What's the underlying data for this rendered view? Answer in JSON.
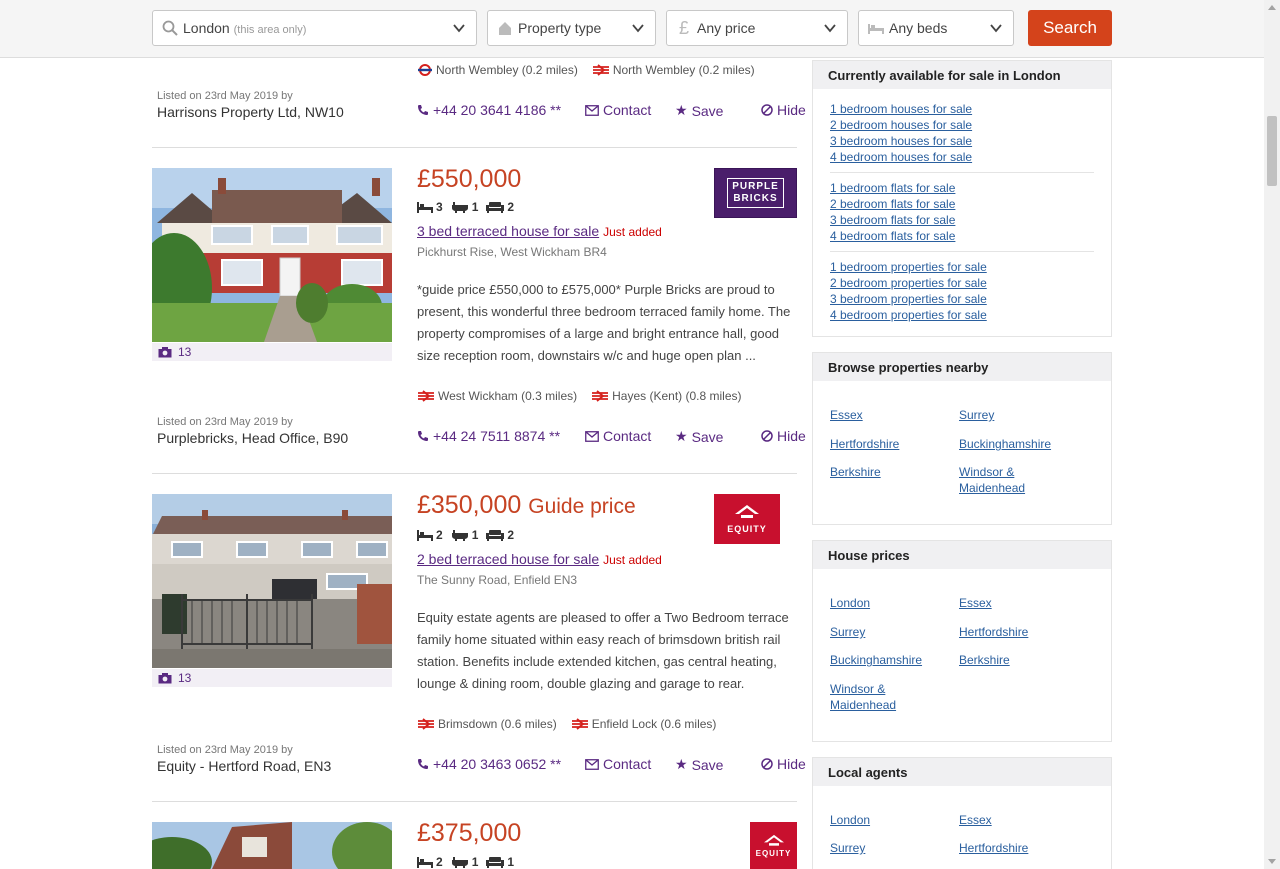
{
  "search": {
    "location": "London",
    "location_hint": "(this area only)",
    "property_type": "Property type",
    "price": "Any price",
    "beds": "Any beds",
    "button": "Search"
  },
  "listing0": {
    "station_tube": "North Wembley (0.2 miles)",
    "station_rail": "North Wembley (0.2 miles)",
    "listed_on": "Listed on 23rd May 2019 by",
    "agent": "Harrisons Property Ltd, NW10",
    "phone": "+44 20 3641 4186 **",
    "contact": "Contact",
    "save": "Save",
    "hide": "Hide"
  },
  "listing1": {
    "price": "£550,000",
    "beds": "3",
    "baths": "1",
    "receptions": "2",
    "title": "3 bed terraced house for sale",
    "badge": "Just added",
    "address": "Pickhurst Rise, West Wickham BR4",
    "description": "*guide price £550,000 to £575,000* Purple Bricks are proud to present, this wonderful three bedroom terraced family home. The property compromises of a large and bright entrance hall, good size reception room, downstairs w/c and huge open plan ...",
    "photos": "13",
    "logo_line1": "PURPLE",
    "logo_line2": "BRICKS",
    "station1": "West Wickham (0.3 miles)",
    "station2": "Hayes (Kent) (0.8 miles)",
    "listed_on": "Listed on 23rd May 2019 by",
    "agent": "Purplebricks, Head Office, B90",
    "phone": "+44 24 7511 8874 **",
    "contact": "Contact",
    "save": "Save",
    "hide": "Hide"
  },
  "listing2": {
    "price": "£350,000",
    "price_qualifier": "Guide price",
    "beds": "2",
    "baths": "1",
    "receptions": "2",
    "title": "2 bed terraced house for sale",
    "badge": "Just added",
    "address": "The Sunny Road, Enfield EN3",
    "description": "Equity estate agents are pleased to offer a Two Bedroom terrace family home situated within easy reach of brimsdown british rail station. Benefits include extended kitchen, gas central heating, lounge & dining room, double glazing and garage to rear.",
    "photos": "13",
    "logo_text": "EQUITY",
    "station1": "Brimsdown (0.6 miles)",
    "station2": "Enfield Lock (0.6 miles)",
    "listed_on": "Listed on 23rd May 2019 by",
    "agent": "Equity - Hertford Road, EN3",
    "phone": "+44 20 3463 0652 **",
    "contact": "Contact",
    "save": "Save",
    "hide": "Hide"
  },
  "listing3": {
    "price": "£375,000",
    "beds": "2",
    "baths": "1",
    "receptions": "1",
    "logo_text": "EQUITY"
  },
  "sidebar": {
    "available": {
      "heading": "Currently available for sale in London",
      "houses": [
        "1 bedroom houses for sale",
        "2 bedroom houses for sale",
        "3 bedroom houses for sale",
        "4 bedroom houses for sale"
      ],
      "flats": [
        "1 bedroom flats for sale",
        "2 bedroom flats for sale",
        "3 bedroom flats for sale",
        "4 bedroom flats for sale"
      ],
      "properties": [
        "1 bedroom properties for sale",
        "2 bedroom properties for sale",
        "3 bedroom properties for sale",
        "4 bedroom properties for sale"
      ]
    },
    "nearby": {
      "heading": "Browse properties nearby",
      "links": [
        "Essex",
        "Surrey",
        "Hertfordshire",
        "Buckinghamshire",
        "Berkshire",
        "Windsor &",
        "Maidenhead"
      ]
    },
    "house_prices": {
      "heading": "House prices",
      "links": [
        "London",
        "Essex",
        "Surrey",
        "Hertfordshire",
        "Buckinghamshire",
        "Berkshire",
        "Windsor &",
        "Maidenhead"
      ]
    },
    "agents": {
      "heading": "Local agents",
      "links": [
        "London",
        "Essex",
        "Surrey",
        "Hertfordshire"
      ]
    }
  },
  "colors": {
    "accent": "#d4431b",
    "price": "#c64323",
    "brand_purple": "#5a2a82",
    "link": "#2a5f9e",
    "equity_red": "#c8102e"
  }
}
